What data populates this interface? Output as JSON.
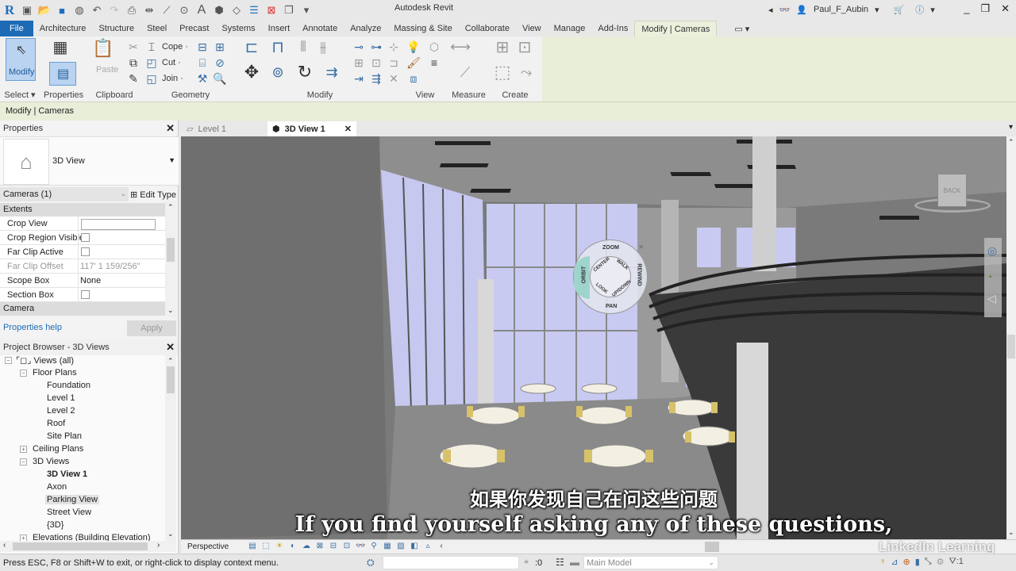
{
  "app": {
    "title": "Autodesk Revit",
    "user": "Paul_F_Aubin"
  },
  "qat_icons": [
    "revit-logo-icon",
    "open-icon",
    "save-icon",
    "sync-icon",
    "undo-icon",
    "redo-icon",
    "print-icon",
    "measure-icon",
    "dimension-icon",
    "tag-icon",
    "text-icon",
    "3d-view-icon",
    "section-icon",
    "thin-lines-icon",
    "close-hidden-icon",
    "switch-windows-icon",
    "customize-icon"
  ],
  "ribbon_tabs": [
    "File",
    "Architecture",
    "Structure",
    "Steel",
    "Precast",
    "Systems",
    "Insert",
    "Annotate",
    "Analyze",
    "Massing & Site",
    "Collaborate",
    "View",
    "Manage",
    "Add-Ins",
    "Modify | Cameras"
  ],
  "active_tab": "Modify | Cameras",
  "ribbon": {
    "modify_label": "Modify",
    "paste_label": "Paste",
    "cope_label": "Cope",
    "cut_label": "Cut",
    "join_label": "Join",
    "panels": [
      "Select",
      "Properties",
      "Clipboard",
      "Geometry",
      "Modify",
      "View",
      "Measure",
      "Create"
    ]
  },
  "options_bar": {
    "context": "Modify | Cameras"
  },
  "properties": {
    "title": "Properties",
    "type_name": "3D View",
    "instance_selector": "Cameras (1)",
    "edit_type": "Edit Type",
    "groups": [
      "Extents",
      "Camera"
    ],
    "rows": [
      {
        "name": "Crop View",
        "value": "",
        "checkbox": true
      },
      {
        "name": "Crop Region Visible",
        "value": "",
        "checkbox": true
      },
      {
        "name": "Far Clip Active",
        "value": "",
        "checkbox": true
      },
      {
        "name": "Far Clip Offset",
        "value": "117'  1 159/256\"",
        "checkbox": false
      },
      {
        "name": "Scope Box",
        "value": "None",
        "checkbox": false
      },
      {
        "name": "Section Box",
        "value": "",
        "checkbox": true
      }
    ],
    "help_link": "Properties help",
    "apply": "Apply"
  },
  "project_browser": {
    "title": "Project Browser - 3D Views",
    "nodes": [
      {
        "label": "Views (all)"
      },
      {
        "label": "Floor Plans"
      },
      {
        "label": "Foundation"
      },
      {
        "label": "Level 1"
      },
      {
        "label": "Level 2"
      },
      {
        "label": "Roof"
      },
      {
        "label": "Site Plan"
      },
      {
        "label": "Ceiling Plans"
      },
      {
        "label": "3D Views"
      },
      {
        "label": "3D View 1"
      },
      {
        "label": "Axon"
      },
      {
        "label": "Parking View"
      },
      {
        "label": "Street View"
      },
      {
        "label": "{3D}"
      },
      {
        "label": "Elevations (Building Elevation)"
      }
    ]
  },
  "view_tabs": [
    {
      "label": "Level 1"
    },
    {
      "label": "3D View 1"
    }
  ],
  "steering_wheel": {
    "zoom": "ZOOM",
    "orbit": "ORBIT",
    "pan": "PAN",
    "rewind": "REWIND",
    "center": "CENTER",
    "walk": "WALK",
    "look": "LOOK",
    "updown": "UP/DOWN"
  },
  "viewcube": {
    "face": "BACK"
  },
  "view_control_bar": {
    "projection": "Perspective"
  },
  "status_bar": {
    "message": "Press ESC, F8 or Shift+W to exit, or right-click to display context menu.",
    "selection_count": ":0",
    "model": "Main Model",
    "filter_count": ":1"
  },
  "subtitles": {
    "cn": "如果你发现自己在问这些问题",
    "en": "If you find yourself asking any of these questions,"
  },
  "watermark": {
    "brand": "LinkedIn Learning"
  }
}
